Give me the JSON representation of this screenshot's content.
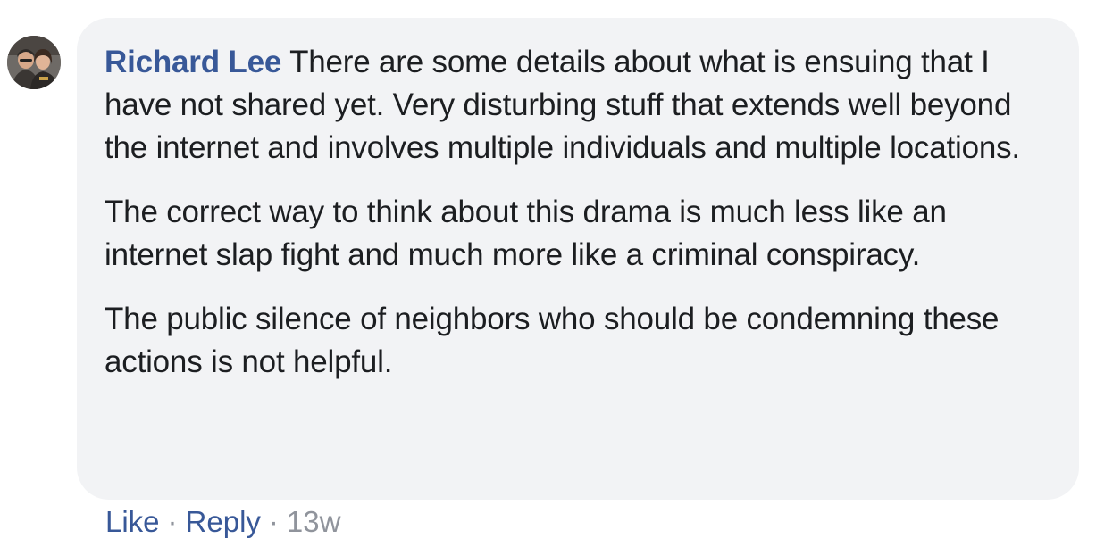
{
  "comment": {
    "author": "Richard Lee",
    "avatar_icon": "user-avatar-photo",
    "paragraphs": [
      "There are some details about what is ensuing that I have not shared yet. Very disturbing stuff that extends well beyond the internet and involves multiple individuals and multiple locations.",
      "The correct way to think about this drama is much less like an internet slap fight and much more like a criminal conspiracy.",
      "The public silence of neighbors who should be condemning these actions is not helpful."
    ],
    "actions": {
      "like_label": "Like",
      "reply_label": "Reply",
      "separator": "·",
      "timestamp": "13w"
    }
  },
  "colors": {
    "bubble_bg": "#f2f3f5",
    "author": "#385898",
    "link": "#385898",
    "text": "#1c1e21",
    "meta": "#90949c"
  }
}
